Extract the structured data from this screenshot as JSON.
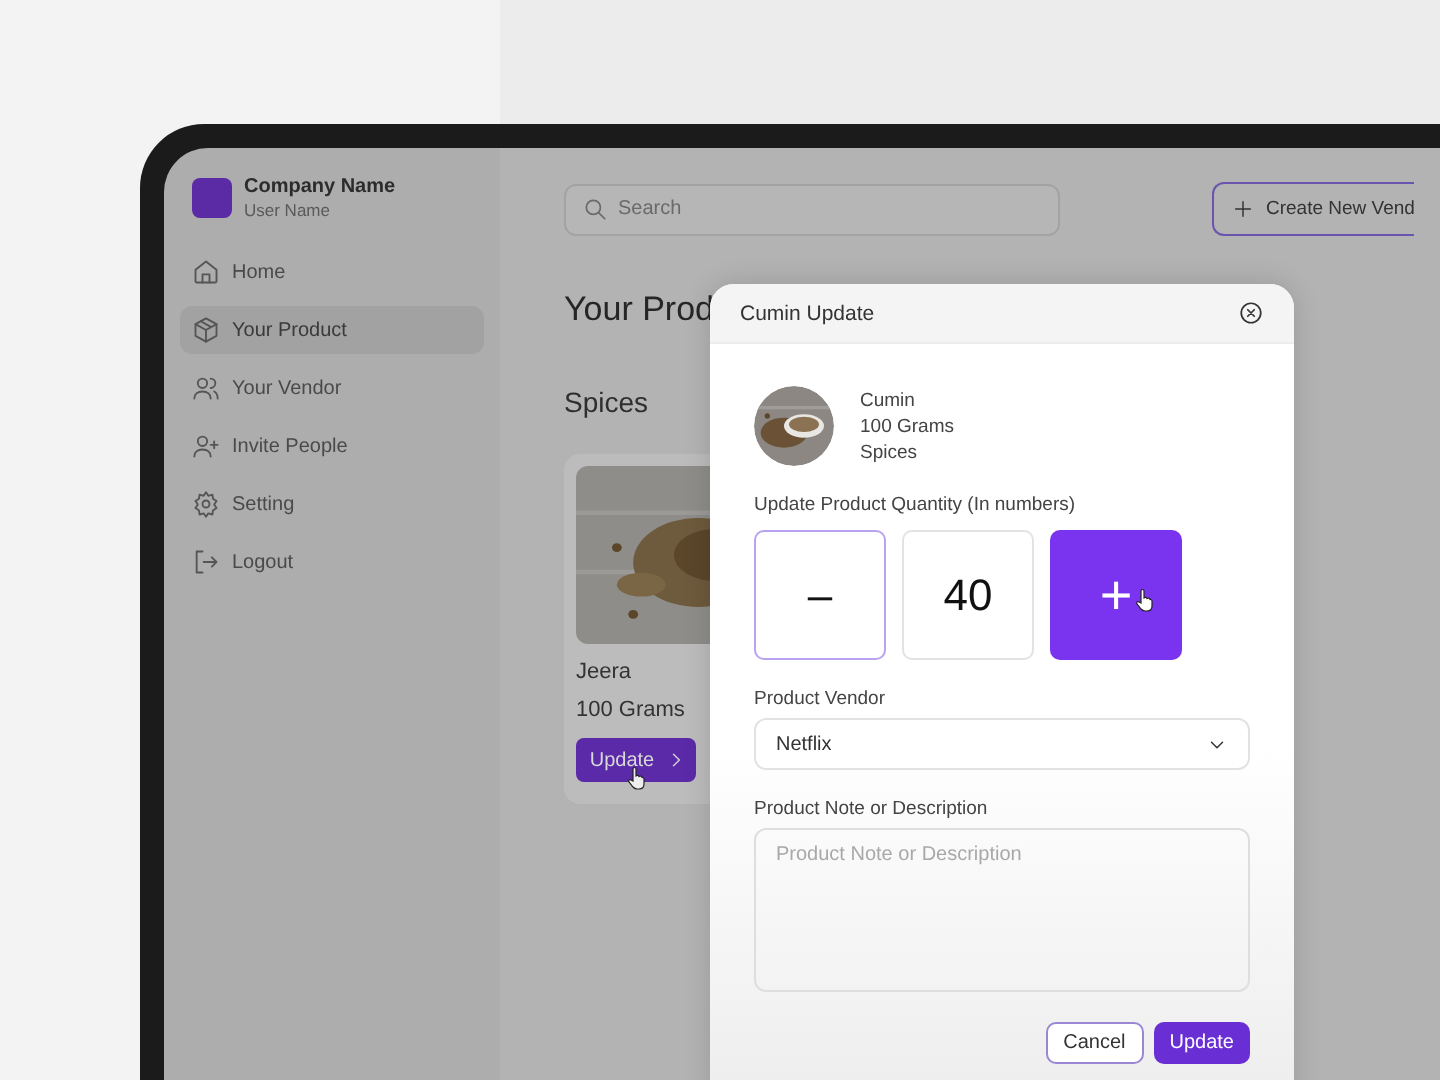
{
  "company": {
    "name": "Company Name",
    "user": "User Name"
  },
  "sidebar": {
    "items": [
      {
        "label": "Home",
        "kind": "home",
        "selected": false
      },
      {
        "label": "Your Product",
        "kind": "box",
        "selected": true
      },
      {
        "label": "Your Vendor",
        "kind": "users",
        "selected": false
      },
      {
        "label": "Invite People",
        "kind": "invite",
        "selected": false
      },
      {
        "label": "Setting",
        "kind": "gear",
        "selected": false
      },
      {
        "label": "Logout",
        "kind": "logout",
        "selected": false
      }
    ]
  },
  "search": {
    "placeholder": "Search"
  },
  "create_button": {
    "label": "Create New Vend"
  },
  "page_title": "Your Prod",
  "section": "Spices",
  "product_card": {
    "name": "Jeera",
    "size": "100 Grams",
    "button": "Update"
  },
  "modal": {
    "title": "Cumin Update",
    "product": {
      "name": "Cumin",
      "size": "100 Grams",
      "category": "Spices"
    },
    "quantity_label": "Update Product Quantity (In numbers)",
    "minus": "–",
    "quantity": "40",
    "plus": "+",
    "vendor_label": "Product Vendor",
    "vendor": "Netflix",
    "note_label": "Product Note or Description",
    "note": {
      "placeholder": "Product Note or Description"
    },
    "cancel": "Cancel",
    "update": "Update"
  }
}
